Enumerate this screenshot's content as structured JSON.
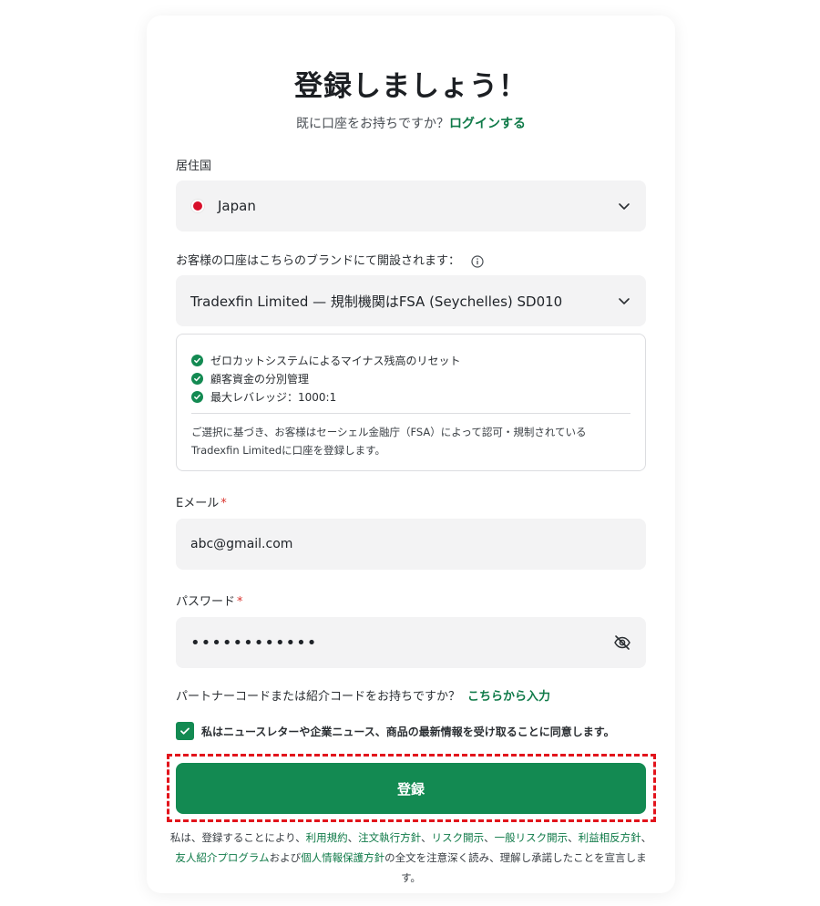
{
  "header": {
    "title": "登録しましょう！",
    "subtitle_text": "既に口座をお持ちですか？",
    "login_link": "ログインする"
  },
  "country": {
    "label": "居住国",
    "value": "Japan"
  },
  "brand": {
    "label": "お客様の口座はこちらのブランドにて開設されます：",
    "value": "Tradexfin Limited — 規制機関はFSA (Seychelles) SD010"
  },
  "benefits": {
    "items": [
      "ゼロカットシステムによるマイナス残高のリセット",
      "顧客資金の分別管理",
      "最大レバレッジ：1000:1"
    ],
    "note": "ご選択に基づき、お客様はセーシェル金融庁（FSA）によって認可・規制されているTradexfin Limitedに口座を登録します。"
  },
  "email": {
    "label": "Eメール",
    "required_mark": "*",
    "value": "abc@gmail.com"
  },
  "password": {
    "label": "パスワード",
    "required_mark": "*",
    "value": "••••••••••••"
  },
  "partner": {
    "text": "パートナーコードまたは紹介コードをお持ちですか？",
    "link": "こちらから入力"
  },
  "consent": {
    "checked": true,
    "text": "私はニュースレターや企業ニュース、商品の最新情報を受け取ることに同意します。"
  },
  "submit": {
    "label": "登録"
  },
  "legal": {
    "prefix": "私は、登録することにより、",
    "link_terms": "利用規約",
    "sep1": "、",
    "link_execution": "注文執行方針",
    "sep2": "、",
    "link_risk": "リスク開示",
    "sep3": "、",
    "link_general_risk": "一般リスク開示",
    "sep4": "、",
    "link_conflict": "利益相反方針",
    "sep5": "、",
    "link_referral": "友人紹介プログラム",
    "and": "および",
    "link_privacy": "個人情報保護方針",
    "suffix": "の全文を注意深く読み、理解し承諾したことを宣言します。"
  },
  "colors": {
    "accent": "#138a52",
    "link": "#0f7a48",
    "required": "#d9322c",
    "highlight": "#e2141c",
    "field_bg": "#f3f3f4"
  }
}
